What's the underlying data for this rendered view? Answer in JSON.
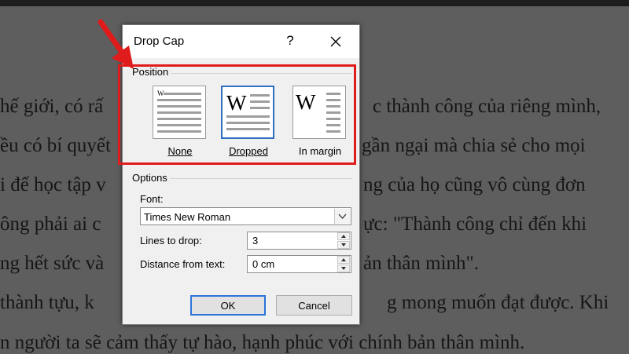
{
  "background": {
    "lines": [
      {
        "left": "hế giới, có rấ",
        "right": "c thành công của riêng mình,"
      },
      {
        "left": "ều có bí quyết",
        "right": "gần ngại mà chia sẻ cho mọi"
      },
      {
        "left": "i để học tập v",
        "right": "ng của họ cũng vô cùng đơn"
      },
      {
        "left": "ông phải ai c",
        "right": "ực: \"Thành công chỉ đến khi"
      },
      {
        "left": "ng hết sức và",
        "right": "ản thân mình\"."
      },
      {
        "left": " thành tựu, k",
        "right": "g mong muốn đạt được. Khi"
      },
      {
        "left": "n người ta sẽ cảm thấy tự hào, hạnh phúc với chính bản thân mình.",
        "right": ""
      }
    ]
  },
  "dialog": {
    "title": "Drop Cap",
    "help_label": "?",
    "position_group": {
      "label": "Position",
      "options": [
        {
          "label": "None",
          "preview_letter": "W",
          "selected": false
        },
        {
          "label": "Dropped",
          "preview_letter": "W",
          "selected": true
        },
        {
          "label": "In margin",
          "preview_letter": "W",
          "selected": false
        }
      ]
    },
    "options_group": {
      "label": "Options",
      "font_label": "Font:",
      "font_value": "Times New Roman",
      "lines_label": "Lines to drop:",
      "lines_value": "3",
      "distance_label": "Distance from text:",
      "distance_value": "0 cm"
    },
    "buttons": {
      "ok": "OK",
      "cancel": "Cancel"
    }
  },
  "colors": {
    "highlight": "#e01b1b",
    "selection": "#2e6fc6",
    "arrow": "#e01b1b"
  },
  "icons": [
    "close-icon",
    "dropdown-arrow-icon",
    "spin-up-icon",
    "spin-down-icon",
    "red-arrow-annotation"
  ]
}
